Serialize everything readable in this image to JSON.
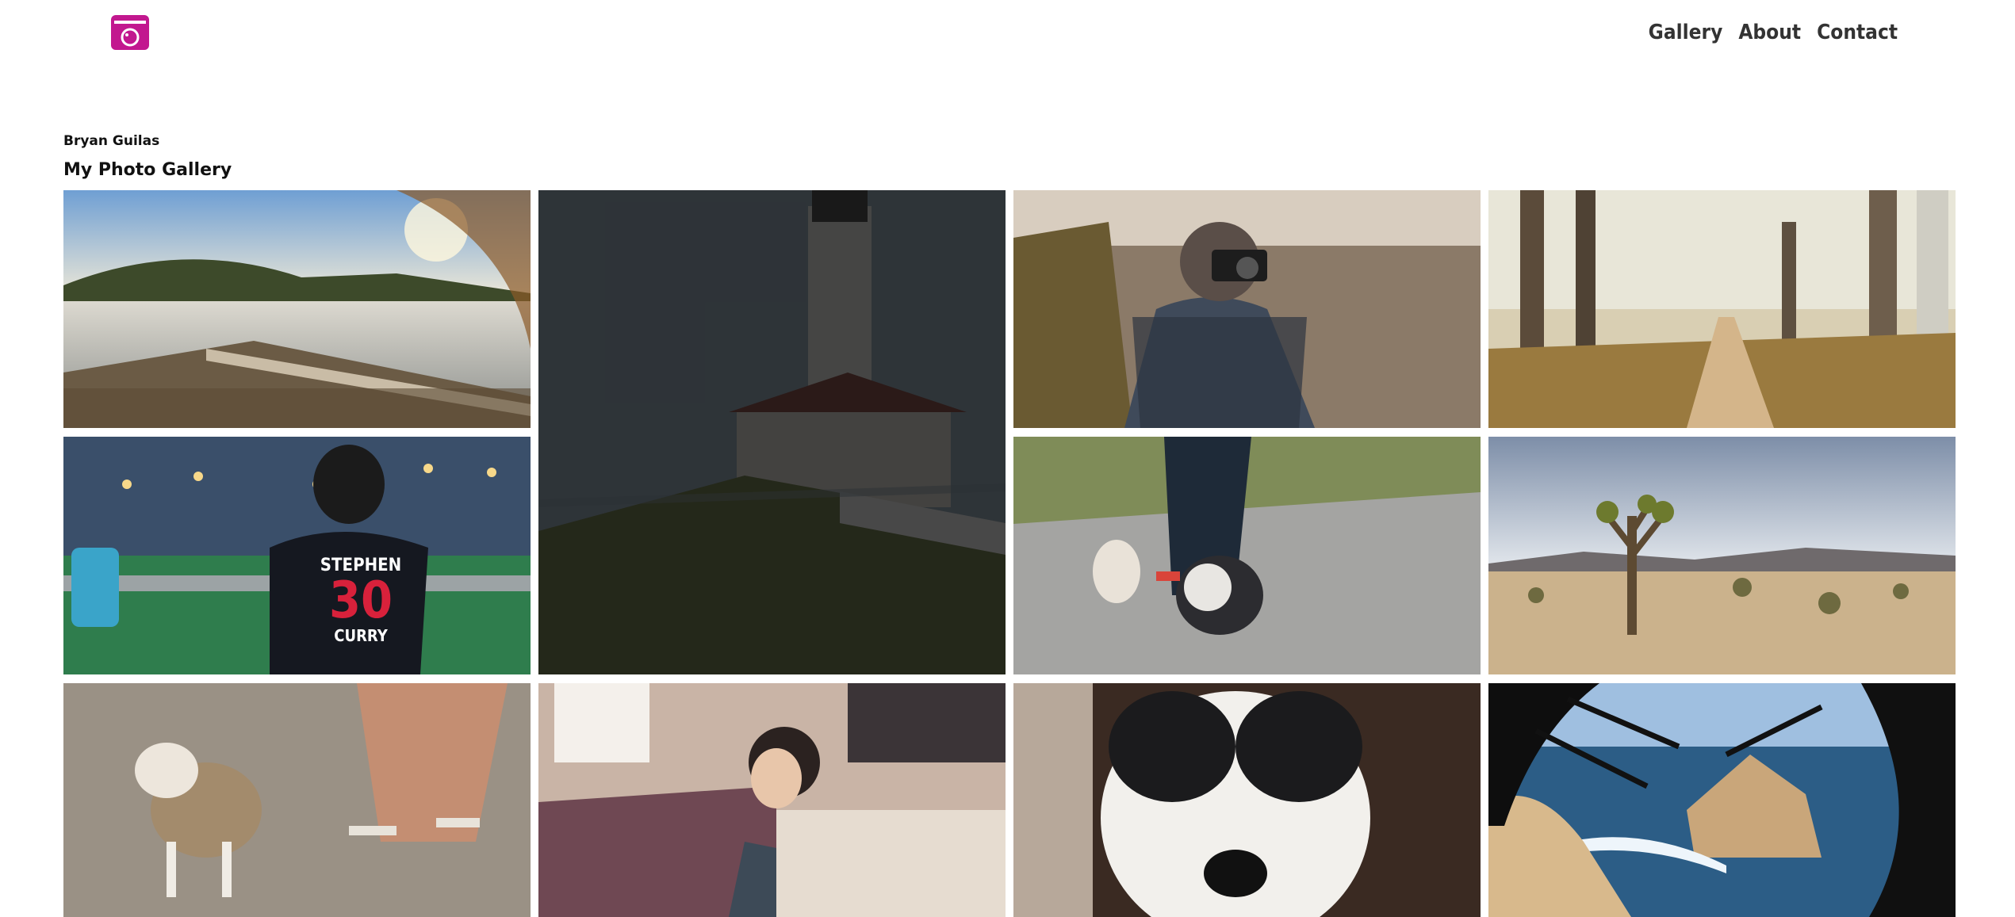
{
  "header": {
    "logo_icon": "camera-icon",
    "accent_color": "#c2188f",
    "nav": {
      "gallery": "Gallery",
      "about": "About",
      "contact": "Contact"
    }
  },
  "page": {
    "author": "Bryan Guilas",
    "title": "My Photo Gallery"
  },
  "gallery": {
    "photos": [
      {
        "subject": "lake-boardwalk"
      },
      {
        "subject": "lighthouse"
      },
      {
        "subject": "photographer-with-camera"
      },
      {
        "subject": "forest-trail"
      },
      {
        "subject": "boy-stephen-curry-jersey"
      },
      {
        "subject": "two-dogs-on-leash"
      },
      {
        "subject": "joshua-tree-desert"
      },
      {
        "subject": "chihuahua-in-sweater"
      },
      {
        "subject": "toddler-by-bed"
      },
      {
        "subject": "fluffy-dog-closeup"
      },
      {
        "subject": "coastal-rocks-trees"
      }
    ],
    "jersey": {
      "name": "STEPHEN",
      "number": "30",
      "surname": "CURRY"
    }
  }
}
